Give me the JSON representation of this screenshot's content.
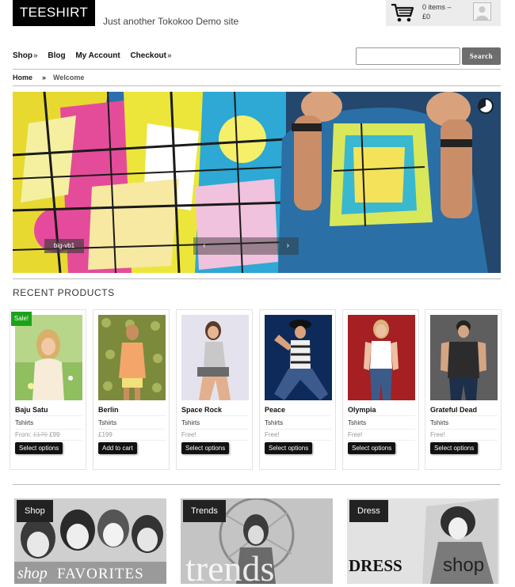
{
  "site": {
    "title": "TEESHIRT",
    "tagline": "Just another Tokokoo Demo site"
  },
  "cart": {
    "items": "0 items –",
    "total": "£0"
  },
  "nav": {
    "items": [
      {
        "label": "Shop",
        "arrow": "»"
      },
      {
        "label": "Blog",
        "arrow": ""
      },
      {
        "label": "My Account",
        "arrow": ""
      },
      {
        "label": "Checkout",
        "arrow": "»"
      }
    ]
  },
  "search": {
    "value": "",
    "placeholder": "",
    "button": "Search"
  },
  "breadcrumb": {
    "home": "Home",
    "separator": "»",
    "current": "Welcome"
  },
  "slider": {
    "caption": "big-vb1",
    "prev": "‹",
    "next": "›"
  },
  "recent": {
    "title": "RECENT PRODUCTS",
    "sale_badge": "Sale!",
    "products": [
      {
        "name": "Baju Satu",
        "category": "Tshirts",
        "price_prefix": "From: ",
        "price_old": "£170",
        "price": " £99",
        "button": "Select options"
      },
      {
        "name": "Berlin",
        "category": "Tshirts",
        "price_prefix": "",
        "price_old": "",
        "price": "£199",
        "button": "Add to cart"
      },
      {
        "name": "Space Rock",
        "category": "Tshirts",
        "price_prefix": "",
        "price_old": "",
        "price": "Free!",
        "button": "Select options"
      },
      {
        "name": "Peace",
        "category": "Tshirts",
        "price_prefix": "",
        "price_old": "",
        "price": "Free!",
        "button": "Select options"
      },
      {
        "name": "Olympia",
        "category": "Tshirts",
        "price_prefix": "",
        "price_old": "",
        "price": "Free!",
        "button": "Select options"
      },
      {
        "name": "Grateful Dead",
        "category": "Tshirts",
        "price_prefix": "",
        "price_old": "",
        "price": "Free!",
        "button": "Select options"
      }
    ]
  },
  "categories": [
    {
      "tag": "Shop",
      "art_a": "shop",
      "art_b": "FAVORITES"
    },
    {
      "tag": "Trends",
      "art_a": "trends",
      "art_b": ""
    },
    {
      "tag": "Dress",
      "art_a": "DRESS",
      "art_b": "shop"
    }
  ],
  "colors": {
    "accent_dark": "#111111",
    "sale_green": "#1aa31a",
    "hero_blue": "#1e4f86",
    "search_button": "#6d6d6d"
  }
}
